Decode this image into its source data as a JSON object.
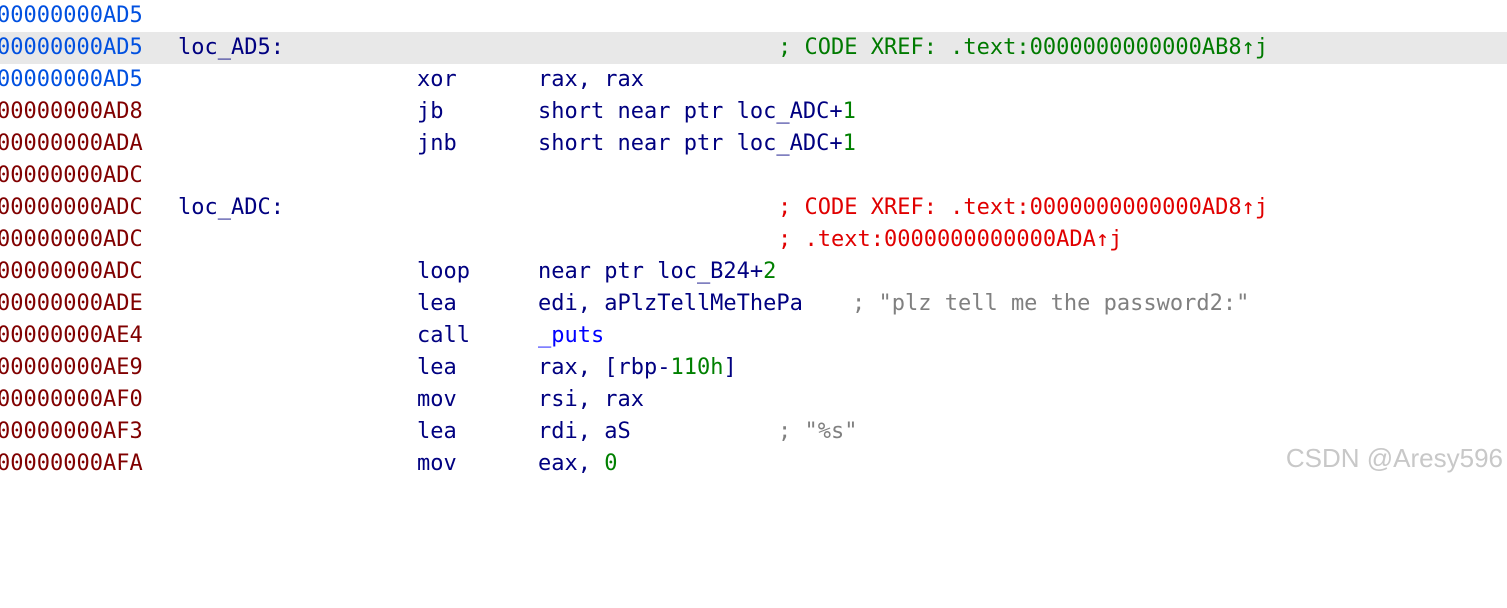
{
  "colors": {
    "address_normal": "#0050e0",
    "address_data": "#800000",
    "instruction": "#000080",
    "xref_resolved": "#007a00",
    "xref_unresolved": "#e00000",
    "comment": "#808080",
    "number": "#008000",
    "highlight": "#e8e8e8"
  },
  "lines": [
    {
      "addr": "00000000AD5"
    },
    {
      "addr": "00000000AD5",
      "label": "loc_AD5:",
      "comment": "; CODE XREF: .text:0000000000000AB8↑j"
    },
    {
      "addr": "00000000AD5",
      "mnem": "xor",
      "op1": "rax, rax"
    },
    {
      "addr": "00000000AD8",
      "mnem": "jb",
      "op1": "short near ptr loc_ADC+",
      "num": "1"
    },
    {
      "addr": "00000000ADA",
      "mnem": "jnb",
      "op1": "short near ptr loc_ADC+",
      "num": "1"
    },
    {
      "addr": "00000000ADC"
    },
    {
      "addr": "00000000ADC",
      "label": "loc_ADC:",
      "comment": "; CODE XREF: .text:0000000000000AD8↑j"
    },
    {
      "addr": "00000000ADC",
      "comment": "; .text:0000000000000ADA↑j"
    },
    {
      "addr": "00000000ADC",
      "mnem": "loop",
      "op1": "near ptr loc_B24+",
      "num": "2"
    },
    {
      "addr": "00000000ADE",
      "mnem": "lea",
      "op1": "edi, aPlzTellMeThePa",
      "comment": "; \"plz tell me the password2:\""
    },
    {
      "addr": "00000000AE4",
      "mnem": "call",
      "op1": "_puts"
    },
    {
      "addr": "00000000AE9",
      "mnem": "lea",
      "op1": "rax, [rbp-",
      "num": "110h",
      "op2": "]"
    },
    {
      "addr": "00000000AF0",
      "mnem": "mov",
      "op1": "rsi, rax"
    },
    {
      "addr": "00000000AF3",
      "mnem": "lea",
      "op1": "rdi, aS",
      "comment": "; \"%s\""
    },
    {
      "addr": "00000000AFA",
      "mnem": "mov",
      "op1": "eax, ",
      "num": "0"
    }
  ],
  "watermark": "CSDN @Aresy596"
}
